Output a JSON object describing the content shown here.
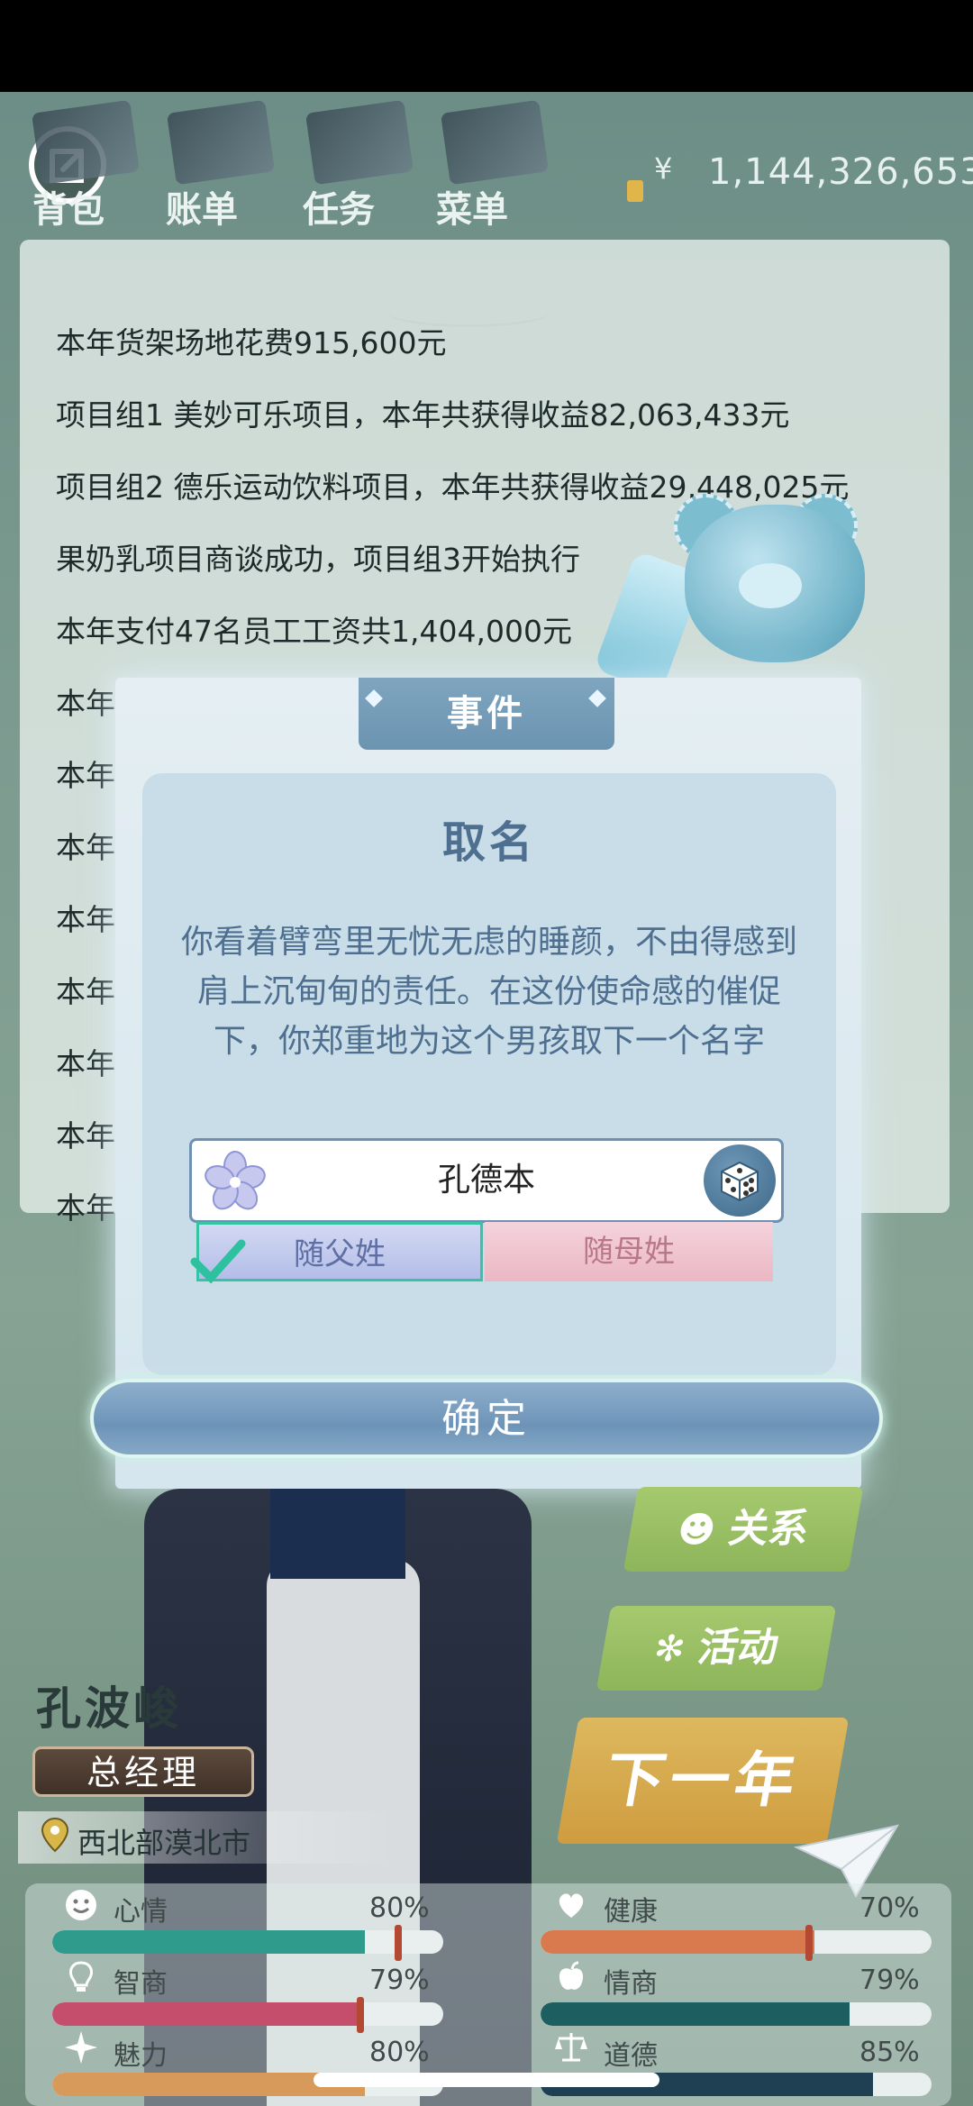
{
  "topbar": {
    "nav": [
      {
        "label": "背包"
      },
      {
        "label": "账单"
      },
      {
        "label": "任务"
      },
      {
        "label": "菜单"
      }
    ],
    "currency_symbol": "¥",
    "money": "1,144,326,653"
  },
  "report": {
    "lines": [
      "本年货架场地花费915,600元",
      "项目组1 美妙可乐项目，本年共获得收益82,063,433元",
      "项目组2 德乐运动饮料项目，本年共获得收益29,448,025元",
      "果奶乳项目商谈成功，项目组3开始执行",
      "本年支付47名员工工资共1,404,000元",
      "本年我",
      "本年",
      "本年",
      "本年",
      "本年",
      "本年",
      "本年",
      "本年"
    ]
  },
  "dialog": {
    "tab": "事件",
    "title": "取名",
    "text": "你看着臂弯里无忧无虑的睡颜，不由得感到肩上沉甸甸的责任。在这份使命感的催促下，你郑重地为这个男孩取下一个名字",
    "name_value": "孔德本",
    "surname_father": "随父姓",
    "surname_mother": "随母姓",
    "confirm": "确定"
  },
  "side_menu": {
    "relations": "关系",
    "activities": "活动",
    "next_year": "下一年"
  },
  "character": {
    "name": "孔波峻",
    "title": "总经理",
    "location": "西北部漠北市"
  },
  "stats": [
    {
      "label": "心情",
      "percent": "80%",
      "value": 0.8,
      "color": "#2e9b8c"
    },
    {
      "label": "健康",
      "percent": "70%",
      "value": 0.7,
      "color": "#d8794e"
    },
    {
      "label": "智商",
      "percent": "79%",
      "value": 0.79,
      "color": "#c64e6d"
    },
    {
      "label": "情商",
      "percent": "79%",
      "value": 0.79,
      "color": "#1d5e60"
    },
    {
      "label": "魅力",
      "percent": "80%",
      "value": 0.8,
      "color": "#d79a5a"
    },
    {
      "label": "道德",
      "percent": "85%",
      "value": 0.85,
      "color": "#1f3f52"
    }
  ]
}
